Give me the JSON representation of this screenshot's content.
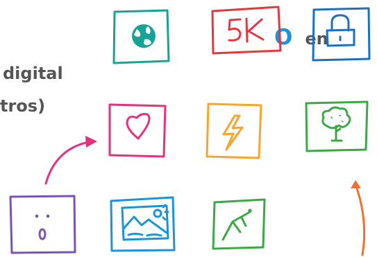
{
  "text": {
    "line1_accent": "O",
    "line1_rest": "en",
    "line2": "digital",
    "line3": "tros)"
  },
  "icons": [
    {
      "name": "globe-icon",
      "color": "#16a396"
    },
    {
      "name": "5k-icon",
      "color": "#e8343f",
      "label": "5K"
    },
    {
      "name": "lock-icon",
      "color": "#1c6fc2"
    },
    {
      "name": "heart-icon",
      "color": "#e6307f"
    },
    {
      "name": "lightning-icon",
      "color": "#f7a52b"
    },
    {
      "name": "tree-icon",
      "color": "#3aa845"
    },
    {
      "name": "surprised-face-icon",
      "color": "#7a52b3"
    },
    {
      "name": "landscape-icon",
      "color": "#1a94d6"
    },
    {
      "name": "climber-icon",
      "color": "#3aa845"
    }
  ],
  "arrows": [
    {
      "name": "arrow-up-right-pink",
      "color": "#e6307f"
    },
    {
      "name": "arrow-up-orange",
      "color": "#f36f2b"
    }
  ]
}
